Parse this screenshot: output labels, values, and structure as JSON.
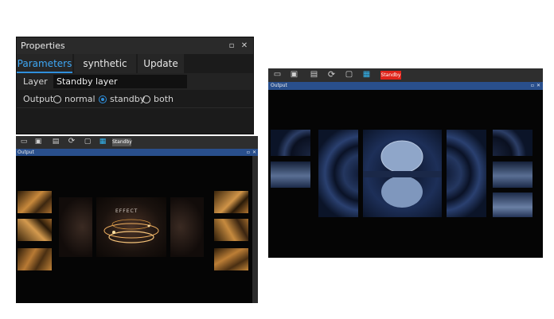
{
  "properties": {
    "title": "Properties",
    "tabs": [
      "Parameters",
      "synthetic",
      "Update"
    ],
    "layer_label": "Layer",
    "layer_value": "Standby layer",
    "output_label": "Output",
    "output_options": [
      "normal",
      "standby",
      "both"
    ],
    "output_selected": "standby"
  },
  "window_left": {
    "badge": "Standby",
    "output_title": "Output",
    "effect_text": "EFFECT"
  },
  "window_right": {
    "badge": "Standby",
    "output_title": "Output"
  },
  "colors": {
    "accent": "#2f8fdc",
    "standby_badge_active": "#e0241b",
    "output_bar": "#294f8c"
  }
}
